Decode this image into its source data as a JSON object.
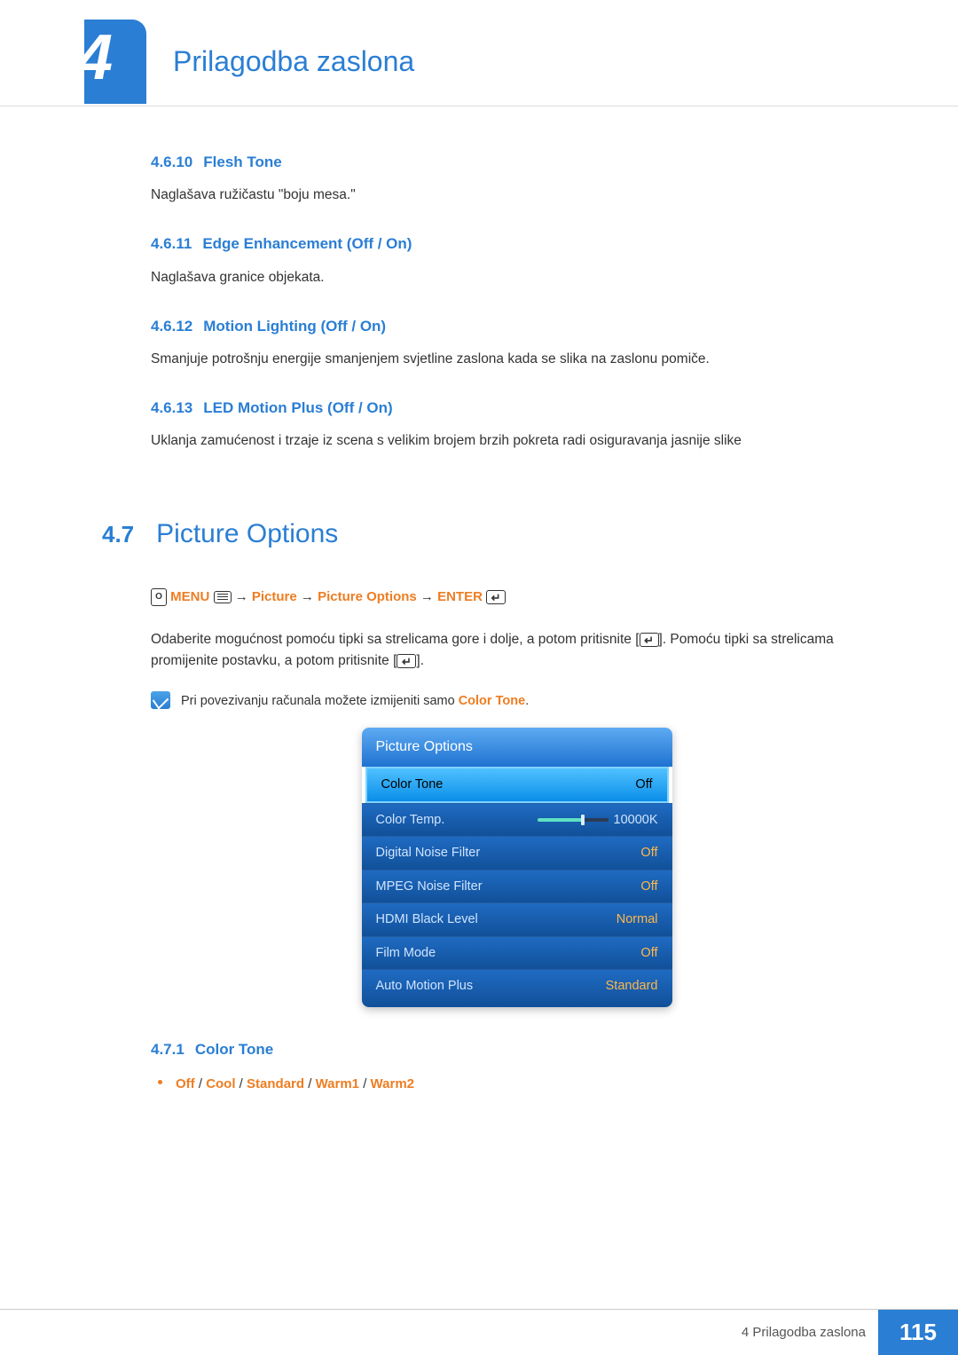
{
  "chapter": {
    "number": "4",
    "title": "Prilagodba zaslona"
  },
  "subsections": [
    {
      "num": "4.6.10",
      "title": "Flesh Tone",
      "body": "Naglašava ružičastu \"boju mesa.\""
    },
    {
      "num": "4.6.11",
      "title": "Edge Enhancement (Off / On)",
      "body": "Naglašava granice objekata."
    },
    {
      "num": "4.6.12",
      "title": "Motion Lighting (Off / On)",
      "body": "Smanjuje potrošnju energije smanjenjem svjetline zaslona kada se slika na zaslonu pomiče."
    },
    {
      "num": "4.6.13",
      "title": "LED Motion Plus (Off / On)",
      "body": "Uklanja zamućenost i trzaje iz scena s velikim brojem brzih pokreta radi osiguravanja jasnije slike"
    }
  ],
  "section47": {
    "num": "4.7",
    "title": "Picture Options"
  },
  "navpath": {
    "menu": "MENU",
    "seg1": "Picture",
    "seg2": "Picture Options",
    "enter": "ENTER"
  },
  "instr": {
    "p1a": "Odaberite mogućnost pomoću tipki sa strelicama gore i dolje, a potom pritisnite [",
    "p1b": "]. Pomoću tipki sa strelicama promijenite postavku, a potom pritisnite [",
    "p1c": "]."
  },
  "note": {
    "pre": "Pri povezivanju računala možete izmijeniti samo ",
    "hl": "Color Tone",
    "post": "."
  },
  "osd": {
    "title": "Picture Options",
    "rows": [
      {
        "label": "Color Tone",
        "value": "Off",
        "selected": true
      },
      {
        "label": "Color Temp.",
        "value": "10000K",
        "slider": true
      },
      {
        "label": "Digital Noise Filter",
        "value": "Off"
      },
      {
        "label": "MPEG Noise Filter",
        "value": "Off"
      },
      {
        "label": "HDMI Black Level",
        "value": "Normal"
      },
      {
        "label": "Film Mode",
        "value": "Off"
      },
      {
        "label": "Auto Motion Plus",
        "value": "Standard"
      }
    ]
  },
  "sub471": {
    "num": "4.7.1",
    "title": "Color Tone"
  },
  "options471": {
    "o1": "Off",
    "o2": "Cool",
    "o3": "Standard",
    "o4": "Warm1",
    "o5": "Warm2"
  },
  "footer": {
    "text": "4 Prilagodba zaslona",
    "page": "115"
  }
}
